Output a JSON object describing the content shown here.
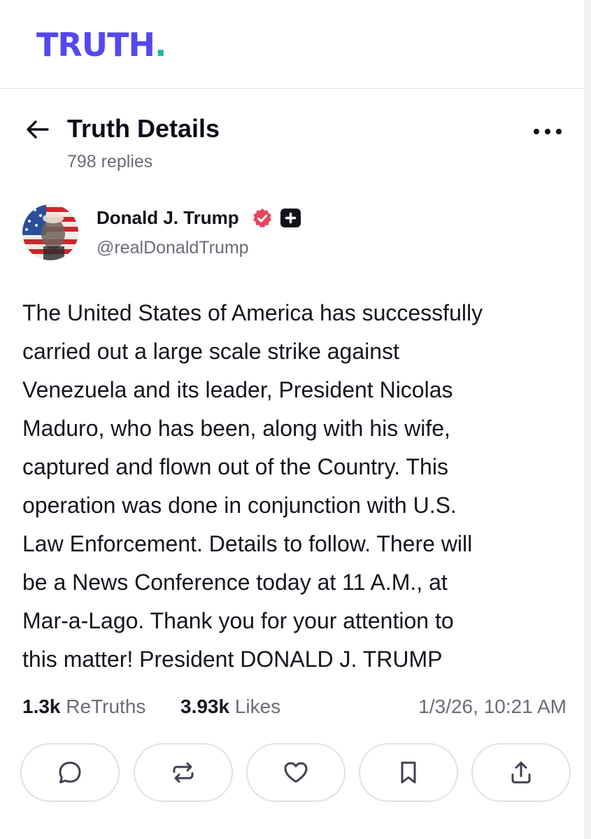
{
  "brand": {
    "logo_text": "TRUTH",
    "logo_dot": ".",
    "primary_color": "#5448ee",
    "dot_color": "#17b8a6"
  },
  "header": {
    "title": "Truth Details",
    "replies": "798 replies",
    "back_icon": "arrow-left-icon",
    "more_icon": "more-dots-icon"
  },
  "author": {
    "name": "Donald J. Trump",
    "handle": "@realDonaldTrump",
    "verified_badge_color": "#e8465e",
    "badges": [
      "verified-icon",
      "plus-badge-icon"
    ]
  },
  "post": {
    "lines": [
      "The United States of America has successfully",
      "carried out a large scale strike against",
      "Venezuela and its leader, President Nicolas",
      "Maduro, who has been, along with his wife,",
      "captured and flown out of the Country. This",
      "operation was done in conjunction with U.S.",
      "Law Enforcement. Details to follow. There will",
      "be a News Conference today at 11 A.M., at",
      "Mar-a-Lago. Thank you for your attention to",
      "this matter! President DONALD J. TRUMP"
    ]
  },
  "stats": {
    "retruths_count": "1.3k",
    "retruths_label": "ReTruths",
    "likes_count": "3.93k",
    "likes_label": "Likes",
    "timestamp": "1/3/26, 10:21 AM"
  },
  "actions": [
    {
      "name": "reply-button",
      "icon": "reply-icon"
    },
    {
      "name": "retruth-button",
      "icon": "retruth-icon"
    },
    {
      "name": "like-button",
      "icon": "heart-icon"
    },
    {
      "name": "bookmark-button",
      "icon": "bookmark-icon"
    },
    {
      "name": "share-button",
      "icon": "share-icon"
    }
  ]
}
